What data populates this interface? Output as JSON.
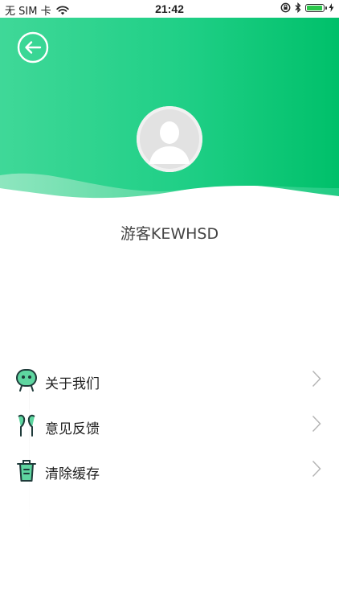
{
  "status_bar": {
    "carrier": "无 SIM 卡",
    "time": "21:42"
  },
  "profile": {
    "username": "游客KEWHSD"
  },
  "menu": [
    {
      "label": "关于我们",
      "icon": "robot-face-icon"
    },
    {
      "label": "意见反馈",
      "icon": "earphones-icon"
    },
    {
      "label": "清除缓存",
      "icon": "trash-icon"
    }
  ],
  "colors": {
    "header_green": "#1fcf86",
    "header_green_dark": "#00c06a",
    "icon_green": "#5ed6a0",
    "icon_dark": "#1f3b3a"
  }
}
